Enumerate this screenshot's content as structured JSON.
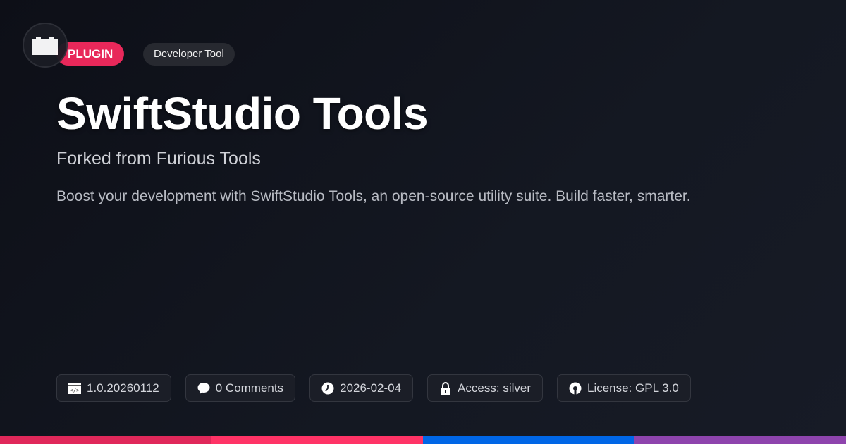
{
  "badges": {
    "type": "PLUGIN",
    "category": "Developer Tool"
  },
  "title": "SwiftStudio Tools",
  "subtitle": "Forked from Furious Tools",
  "description": "Boost your development with SwiftStudio Tools, an open-source utility suite. Build faster, smarter.",
  "meta": {
    "version": "1.0.20260112",
    "comments": "0 Comments",
    "date": "2026-02-04",
    "access": "Access: silver",
    "license": "License: GPL 3.0"
  },
  "colors": {
    "bar": [
      "#e0285a",
      "#ff3366",
      "#0066e6",
      "#8e44ad"
    ],
    "accent": "#e8285a"
  }
}
